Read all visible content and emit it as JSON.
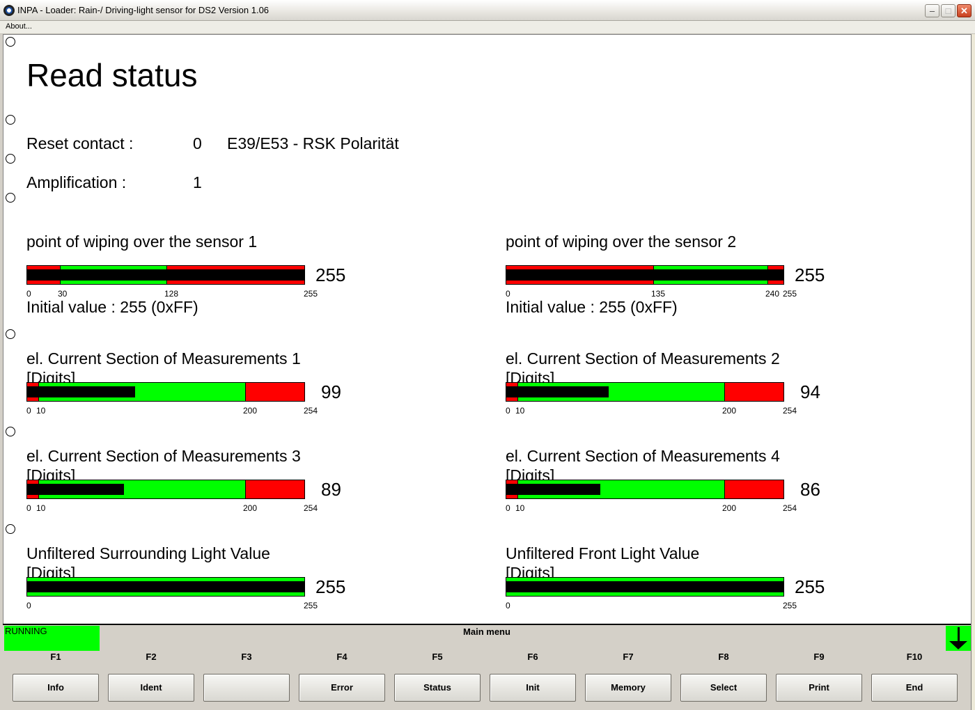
{
  "window": {
    "title": "INPA - Loader:  Rain-/ Driving-light sensor for DS2 Version 1.06",
    "min_glyph": "–",
    "max_glyph": "□",
    "close_glyph": "✕"
  },
  "menu": {
    "about": "About..."
  },
  "page": {
    "title": "Read status",
    "reset_contact_label": "Reset contact :",
    "reset_contact_value": "0",
    "reset_contact_note": "E39/E53 - RSK Polarität",
    "amplification_label": "Amplification :",
    "amplification_value": "1"
  },
  "gauges": [
    {
      "title_line1": "point of wiping over the sensor 1",
      "title_line2": "",
      "min": 0,
      "max": 255,
      "value": 255,
      "value_text": "255",
      "ticks": [
        {
          "v": 0,
          "label": "0"
        },
        {
          "v": 30,
          "label": "30"
        },
        {
          "v": 128,
          "label": "128"
        },
        {
          "v": 255,
          "label": "255"
        }
      ],
      "zones": [
        {
          "from": 0,
          "to": 30,
          "color": "#ff0000"
        },
        {
          "from": 30,
          "to": 128,
          "color": "#00ff00"
        },
        {
          "from": 128,
          "to": 255,
          "color": "#ff0000"
        }
      ],
      "note": "Initial value : 255 (0xFF)"
    },
    {
      "title_line1": "point of wiping over the sensor 2",
      "title_line2": "",
      "min": 0,
      "max": 255,
      "value": 255,
      "value_text": "255",
      "ticks": [
        {
          "v": 0,
          "label": "0"
        },
        {
          "v": 135,
          "label": "135"
        },
        {
          "v": 240,
          "label": "240"
        },
        {
          "v": 255,
          "label": "255"
        }
      ],
      "zones": [
        {
          "from": 0,
          "to": 135,
          "color": "#ff0000"
        },
        {
          "from": 135,
          "to": 240,
          "color": "#00ff00"
        },
        {
          "from": 240,
          "to": 255,
          "color": "#ff0000"
        }
      ],
      "note": "Initial value : 255 (0xFF)"
    },
    {
      "title_line1": "el. Current Section of Measurements 1",
      "title_line2": "[Digits]",
      "min": 0,
      "max": 254,
      "value": 99,
      "value_text": "99",
      "ticks": [
        {
          "v": 0,
          "label": "0"
        },
        {
          "v": 10,
          "label": "10"
        },
        {
          "v": 200,
          "label": "200"
        },
        {
          "v": 254,
          "label": "254"
        }
      ],
      "zones": [
        {
          "from": 0,
          "to": 10,
          "color": "#ff0000"
        },
        {
          "from": 10,
          "to": 200,
          "color": "#00ff00"
        },
        {
          "from": 200,
          "to": 254,
          "color": "#ff0000"
        }
      ],
      "note": ""
    },
    {
      "title_line1": "el. Current Section of Measurements 2",
      "title_line2": "[Digits]",
      "min": 0,
      "max": 254,
      "value": 94,
      "value_text": "94",
      "ticks": [
        {
          "v": 0,
          "label": "0"
        },
        {
          "v": 10,
          "label": "10"
        },
        {
          "v": 200,
          "label": "200"
        },
        {
          "v": 254,
          "label": "254"
        }
      ],
      "zones": [
        {
          "from": 0,
          "to": 10,
          "color": "#ff0000"
        },
        {
          "from": 10,
          "to": 200,
          "color": "#00ff00"
        },
        {
          "from": 200,
          "to": 254,
          "color": "#ff0000"
        }
      ],
      "note": ""
    },
    {
      "title_line1": "el. Current Section of Measurements 3",
      "title_line2": "[Digits]",
      "min": 0,
      "max": 254,
      "value": 89,
      "value_text": "89",
      "ticks": [
        {
          "v": 0,
          "label": "0"
        },
        {
          "v": 10,
          "label": "10"
        },
        {
          "v": 200,
          "label": "200"
        },
        {
          "v": 254,
          "label": "254"
        }
      ],
      "zones": [
        {
          "from": 0,
          "to": 10,
          "color": "#ff0000"
        },
        {
          "from": 10,
          "to": 200,
          "color": "#00ff00"
        },
        {
          "from": 200,
          "to": 254,
          "color": "#ff0000"
        }
      ],
      "note": ""
    },
    {
      "title_line1": "el. Current Section of Measurements 4",
      "title_line2": "[Digits]",
      "min": 0,
      "max": 254,
      "value": 86,
      "value_text": "86",
      "ticks": [
        {
          "v": 0,
          "label": "0"
        },
        {
          "v": 10,
          "label": "10"
        },
        {
          "v": 200,
          "label": "200"
        },
        {
          "v": 254,
          "label": "254"
        }
      ],
      "zones": [
        {
          "from": 0,
          "to": 10,
          "color": "#ff0000"
        },
        {
          "from": 10,
          "to": 200,
          "color": "#00ff00"
        },
        {
          "from": 200,
          "to": 254,
          "color": "#ff0000"
        }
      ],
      "note": ""
    },
    {
      "title_line1": "Unfiltered Surrounding Light Value",
      "title_line2": "[Digits]",
      "min": 0,
      "max": 255,
      "value": 255,
      "value_text": "255",
      "ticks": [
        {
          "v": 0,
          "label": "0"
        },
        {
          "v": 255,
          "label": "255"
        }
      ],
      "zones": [
        {
          "from": 0,
          "to": 255,
          "color": "#00ff00"
        }
      ],
      "note": ""
    },
    {
      "title_line1": "Unfiltered Front Light Value",
      "title_line2": "[Digits]",
      "min": 0,
      "max": 255,
      "value": 255,
      "value_text": "255",
      "ticks": [
        {
          "v": 0,
          "label": "0"
        },
        {
          "v": 255,
          "label": "255"
        }
      ],
      "zones": [
        {
          "from": 0,
          "to": 255,
          "color": "#00ff00"
        }
      ],
      "note": ""
    }
  ],
  "status": {
    "running": "RUNNING",
    "running_color": "#00ff00",
    "menu_title": "Main menu",
    "scroll_icon": "arrow-down-icon"
  },
  "function_keys": [
    {
      "key": "F1",
      "label": "Info"
    },
    {
      "key": "F2",
      "label": "Ident"
    },
    {
      "key": "F3",
      "label": ""
    },
    {
      "key": "F4",
      "label": "Error"
    },
    {
      "key": "F5",
      "label": "Status"
    },
    {
      "key": "F6",
      "label": "Init"
    },
    {
      "key": "F7",
      "label": "Memory"
    },
    {
      "key": "F8",
      "label": "Select"
    },
    {
      "key": "F9",
      "label": "Print"
    },
    {
      "key": "F10",
      "label": "End"
    }
  ]
}
